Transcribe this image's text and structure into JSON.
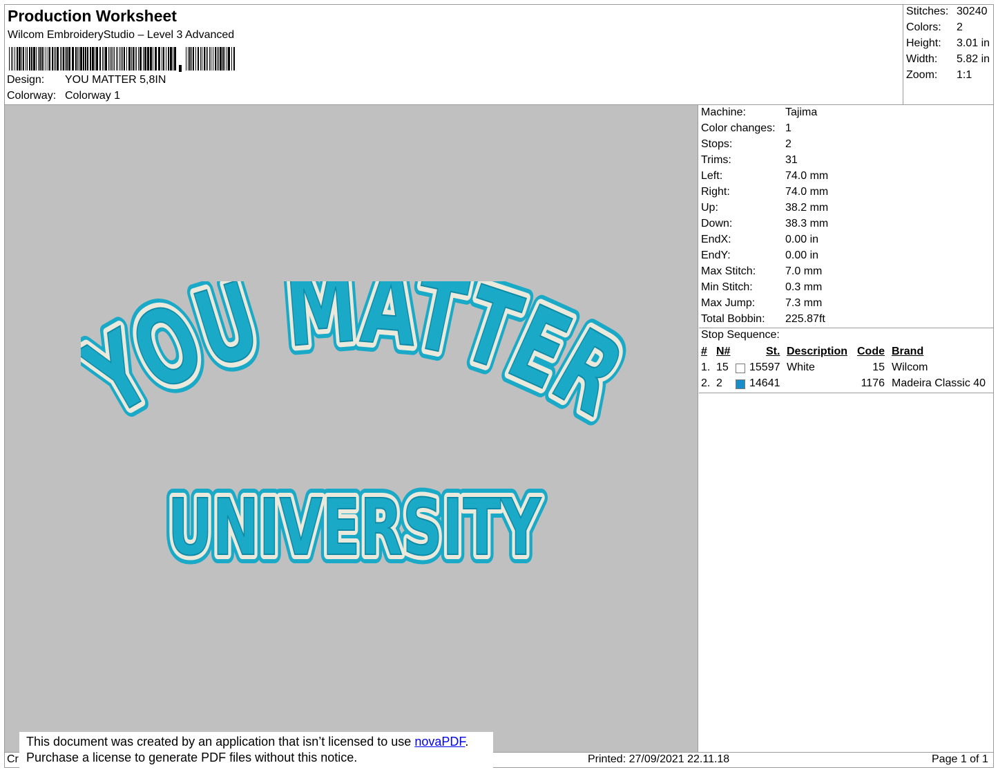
{
  "header": {
    "title": "Production Worksheet",
    "software": "Wilcom EmbroideryStudio – Level 3 Advanced",
    "design_label": "Design:",
    "design_value": "YOU MATTER 5,8IN",
    "colorway_label": "Colorway:",
    "colorway_value": "Colorway 1"
  },
  "summary": [
    {
      "label": "Stitches:",
      "value": "30240"
    },
    {
      "label": "Colors:",
      "value": "2"
    },
    {
      "label": "Height:",
      "value": "3.01 in"
    },
    {
      "label": "Width:",
      "value": "5.82 in"
    },
    {
      "label": "Zoom:",
      "value": "1:1"
    }
  ],
  "design_image": {
    "top_line": "YOU MATTER",
    "bottom_line": "UNIVERSITY",
    "fill_color": "#1aa9c6",
    "outline_color": "#ebe9dc",
    "background_color": "#c0c0c0"
  },
  "details": [
    {
      "label": "Machine:",
      "value": "Tajima"
    },
    {
      "label": "Color changes:",
      "value": "1"
    },
    {
      "label": "Stops:",
      "value": "2"
    },
    {
      "label": "Trims:",
      "value": "31"
    },
    {
      "label": "Left:",
      "value": "74.0 mm"
    },
    {
      "label": "Right:",
      "value": "74.0 mm"
    },
    {
      "label": "Up:",
      "value": "38.2 mm"
    },
    {
      "label": "Down:",
      "value": "38.3 mm"
    },
    {
      "label": "EndX:",
      "value": "0.00 in"
    },
    {
      "label": "EndY:",
      "value": "0.00 in"
    },
    {
      "label": "Max Stitch:",
      "value": "7.0 mm"
    },
    {
      "label": "Min Stitch:",
      "value": "0.3 mm"
    },
    {
      "label": "Max Jump:",
      "value": "7.3 mm"
    },
    {
      "label": "Total Bobbin:",
      "value": "225.87ft"
    }
  ],
  "stop_sequence": {
    "title": "Stop Sequence:",
    "headers": [
      "#",
      "N#",
      "St.",
      "Description",
      "Code",
      "Brand"
    ],
    "rows": [
      {
        "index": "1.",
        "n": "15",
        "swatch": "#ffffff",
        "stitches": "15597",
        "description": "White",
        "code": "15",
        "brand": "Wilcom"
      },
      {
        "index": "2.",
        "n": "2",
        "swatch": "#1a8cc8",
        "stitches": "14641",
        "description": "",
        "code": "1176",
        "brand": "Madeira Classic 40"
      }
    ]
  },
  "footer": {
    "left": "Cr",
    "printed": "Printed: 27/09/2021 22.11.18",
    "page": "Page 1 of 1"
  },
  "notice": {
    "line1_prefix": "This document was created by an application that isn’t licensed to use ",
    "link": "novaPDF",
    "line1_suffix": ".",
    "line2": "Purchase a license to generate PDF files without this notice."
  }
}
